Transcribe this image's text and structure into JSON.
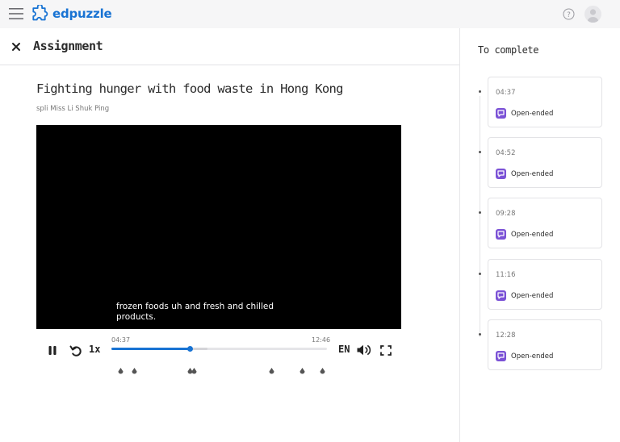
{
  "topbar": {
    "logo_text": "edpuzzle"
  },
  "assignment": {
    "header_title": "Assignment",
    "video_title": "Fighting hunger with food waste in Hong Kong",
    "author": "spli Miss Li Shuk Ping"
  },
  "player": {
    "subtitle": "frozen foods uh and fresh and chilled products.",
    "speed": "1x",
    "current_time": "04:37",
    "duration": "12:46",
    "progress_fraction": 0.362,
    "buffered_fraction": 0.446,
    "language": "EN",
    "question_markers_seconds": [
      31,
      79,
      277,
      292,
      568,
      676,
      748
    ],
    "accent_color": "#1873d3"
  },
  "sidebar": {
    "title": "To complete",
    "questions": [
      {
        "time": "04:37",
        "type": "Open-ended"
      },
      {
        "time": "04:52",
        "type": "Open-ended"
      },
      {
        "time": "09:28",
        "type": "Open-ended"
      },
      {
        "time": "11:16",
        "type": "Open-ended"
      },
      {
        "time": "12:28",
        "type": "Open-ended"
      }
    ],
    "question_icon_color": "#7b52d6"
  }
}
